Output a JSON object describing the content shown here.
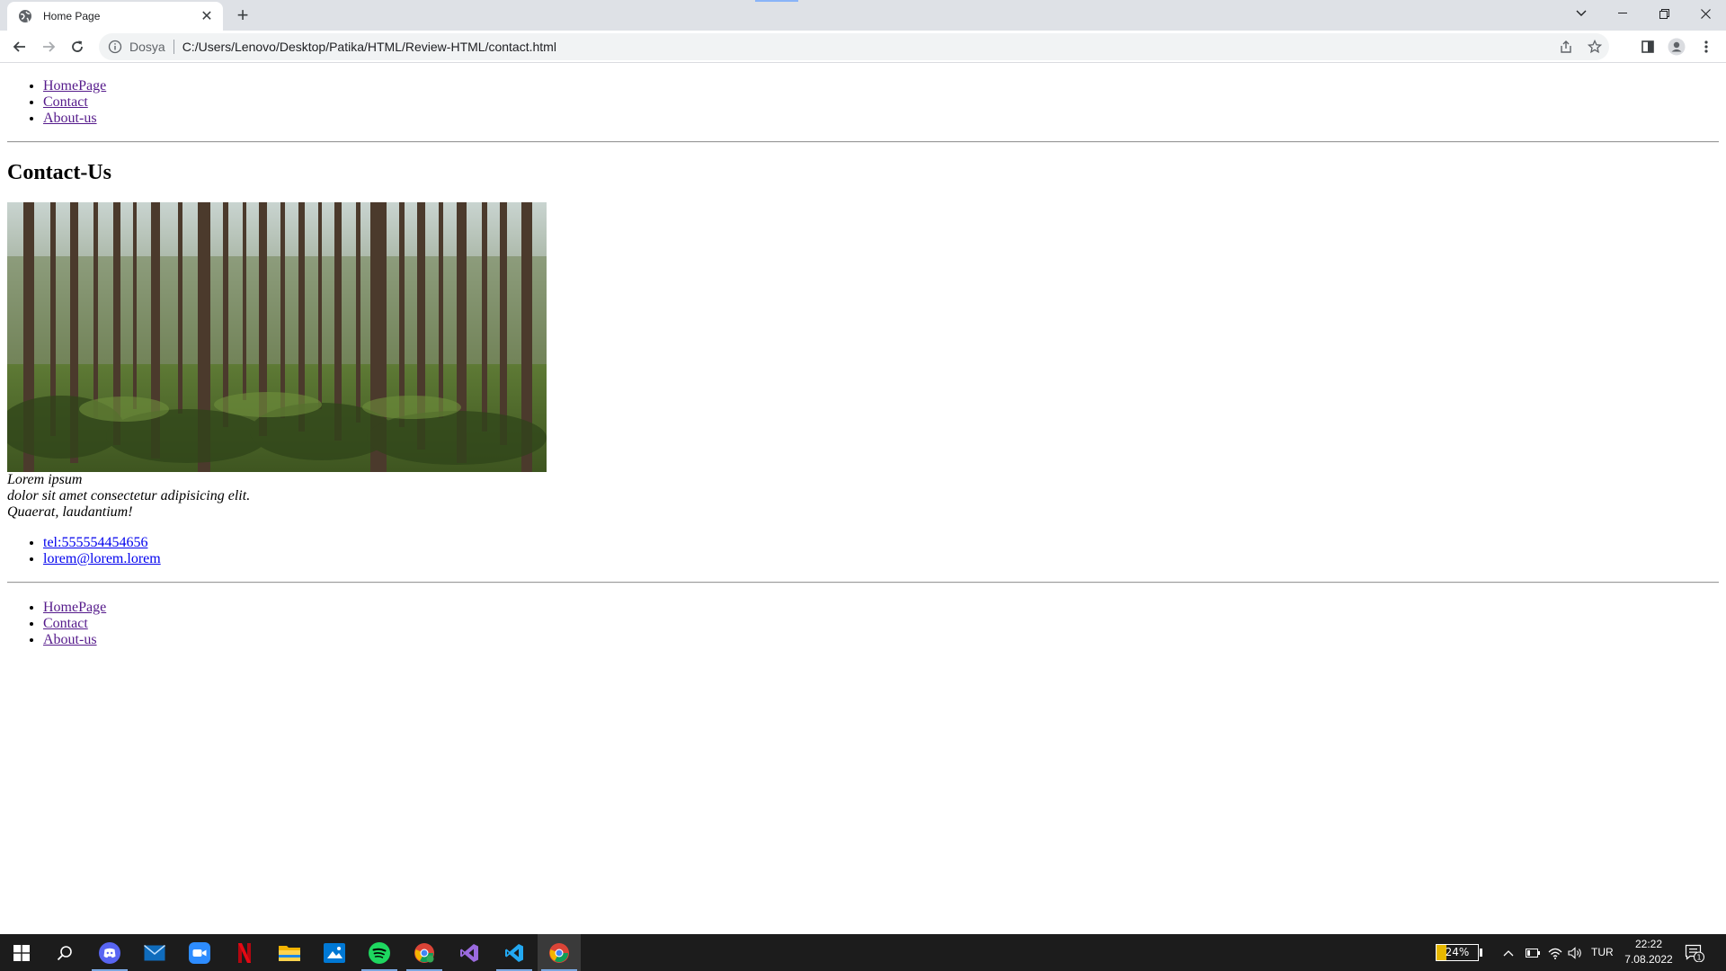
{
  "browser": {
    "tab_title": "Home Page",
    "tab_close": "✕",
    "new_tab": "+",
    "omnibox_label": "Dosya",
    "url": "C:/Users/Lenovo/Desktop/Patika/HTML/Review-HTML/contact.html"
  },
  "top_nav": {
    "items": [
      {
        "label": "HomePage"
      },
      {
        "label": "Contact"
      },
      {
        "label": "About-us"
      }
    ]
  },
  "main": {
    "title": "Contact-Us",
    "lorem_lines": [
      "Lorem ipsum",
      "dolor sit amet consectetur adipisicing elit.",
      "Quaerat, laudantium!"
    ],
    "contact_links": [
      {
        "label": "tel:555554454656"
      },
      {
        "label": "lorem@lorem.lorem"
      }
    ]
  },
  "bottom_nav": {
    "items": [
      {
        "label": "HomePage"
      },
      {
        "label": "Contact"
      },
      {
        "label": "About-us"
      }
    ]
  },
  "taskbar": {
    "apps": [
      "start-icon",
      "search-icon",
      "discord-icon",
      "mail-icon",
      "zoom-icon",
      "netflix-icon",
      "file-explorer-icon",
      "photos-icon",
      "spotify-icon",
      "chrome-profile-icon",
      "visual-studio-icon",
      "vscode-icon",
      "chrome-icon"
    ],
    "battery_percent": "24%",
    "battery_level": 0.24,
    "language": "TUR",
    "time": "22:22",
    "date": "7.08.2022",
    "notification_count": "1"
  },
  "colors": {
    "visited_link": "#551a8b",
    "unvisited_link": "#0000ee",
    "tabstrip": "#dee1e6",
    "taskbar": "#1c1c1c"
  }
}
